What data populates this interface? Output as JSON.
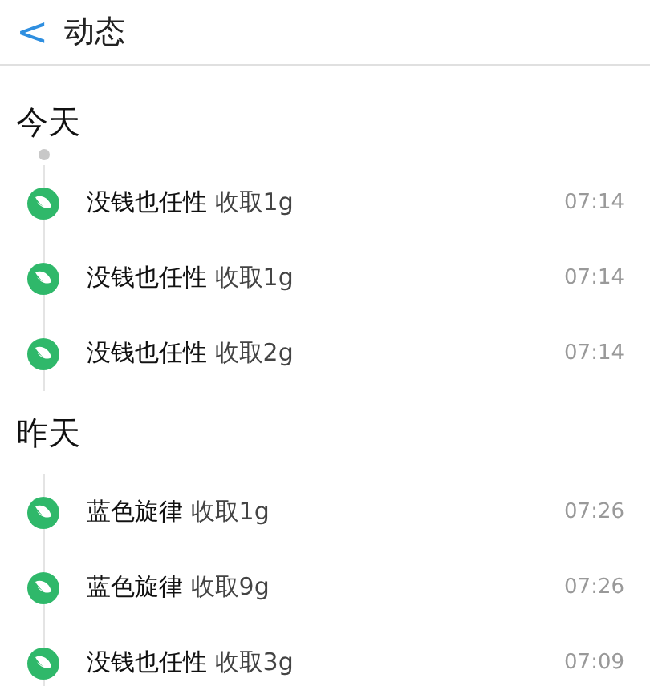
{
  "header": {
    "back": "<",
    "title": "动态"
  },
  "groups": [
    {
      "label": "今天",
      "show_dot": true,
      "items": [
        {
          "name": "没钱也任性",
          "action": "收取1g",
          "time": "07:14"
        },
        {
          "name": "没钱也任性",
          "action": "收取1g",
          "time": "07:14"
        },
        {
          "name": "没钱也任性",
          "action": "收取2g",
          "time": "07:14"
        }
      ]
    },
    {
      "label": "昨天",
      "show_dot": false,
      "items": [
        {
          "name": "蓝色旋律",
          "action": "收取1g",
          "time": "07:26"
        },
        {
          "name": "蓝色旋律",
          "action": "收取9g",
          "time": "07:26"
        },
        {
          "name": "没钱也任性",
          "action": "收取3g",
          "time": "07:09"
        }
      ]
    }
  ]
}
